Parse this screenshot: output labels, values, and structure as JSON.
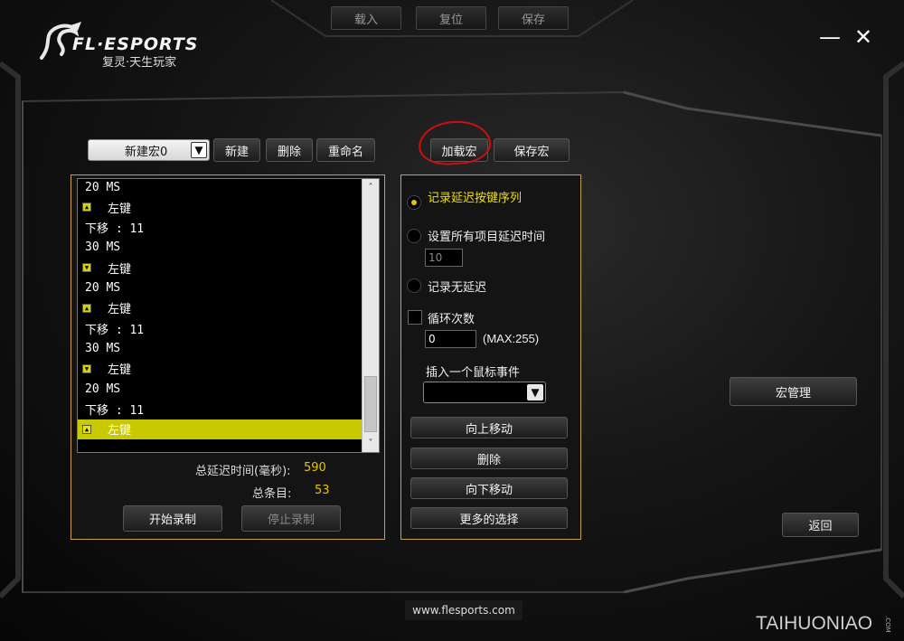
{
  "top_toolbar": {
    "load_label": "载入",
    "reset_label": "复位",
    "save_label": "保存"
  },
  "logo": {
    "brand": "FL·ESPORTS",
    "tagline": "复灵·天生玩家"
  },
  "window": {
    "minimize_glyph": "—",
    "close_glyph": "✕"
  },
  "macro_bar": {
    "selected_macro": "新建宏0",
    "new_label": "新建",
    "delete_label": "删除",
    "rename_label": "重命名",
    "load_macro_label": "加载宏",
    "save_macro_label": "保存宏"
  },
  "macro_list": {
    "rows": [
      {
        "text": "20 MS",
        "icon": ""
      },
      {
        "text": "左键",
        "icon": "up-arrow"
      },
      {
        "text": "下移 : 11",
        "icon": ""
      },
      {
        "text": "30 MS",
        "icon": ""
      },
      {
        "text": "左键",
        "icon": "down-arrow"
      },
      {
        "text": "20 MS",
        "icon": ""
      },
      {
        "text": "左键",
        "icon": "up-arrow"
      },
      {
        "text": "下移 : 11",
        "icon": ""
      },
      {
        "text": "30 MS",
        "icon": ""
      },
      {
        "text": "左键",
        "icon": "down-arrow"
      },
      {
        "text": "20 MS",
        "icon": ""
      },
      {
        "text": "下移 : 11",
        "icon": ""
      },
      {
        "text": "左键",
        "icon": "up-arrow",
        "selected": true
      }
    ],
    "scroll_up_glyph": "˄",
    "scroll_down_glyph": "˅"
  },
  "stats": {
    "total_delay_label": "总延迟时间(毫秒):",
    "total_delay_value": "590",
    "total_items_label": "总条目:",
    "total_items_value": "53"
  },
  "record": {
    "start_label": "开始录制",
    "stop_label": "停止录制"
  },
  "options": {
    "record_delay_label": "记录延迟按键序列",
    "set_all_delay_label": "设置所有项目延迟时间",
    "delay_value": "10",
    "no_delay_label": "记录无延迟",
    "loop_label": "循环次数",
    "loop_value": "0",
    "loop_max": "(MAX:255)",
    "insert_mouse_label": "插入一个鼠标事件",
    "insert_mouse_value": "",
    "move_up_label": "向上移动",
    "delete_label": "删除",
    "move_down_label": "向下移动",
    "more_label": "更多的选择"
  },
  "side": {
    "macro_manage_label": "宏管理",
    "back_label": "返回"
  },
  "footer": {
    "url": "www.flesports.com",
    "watermark": "TAIHUONIAO",
    "watermark_small": ".COM"
  },
  "colors": {
    "accent_yellow": "#e5c600",
    "panel_border": "#c8a04a",
    "selected_row": "#c9c900",
    "annotation_red": "#d10e0e"
  }
}
